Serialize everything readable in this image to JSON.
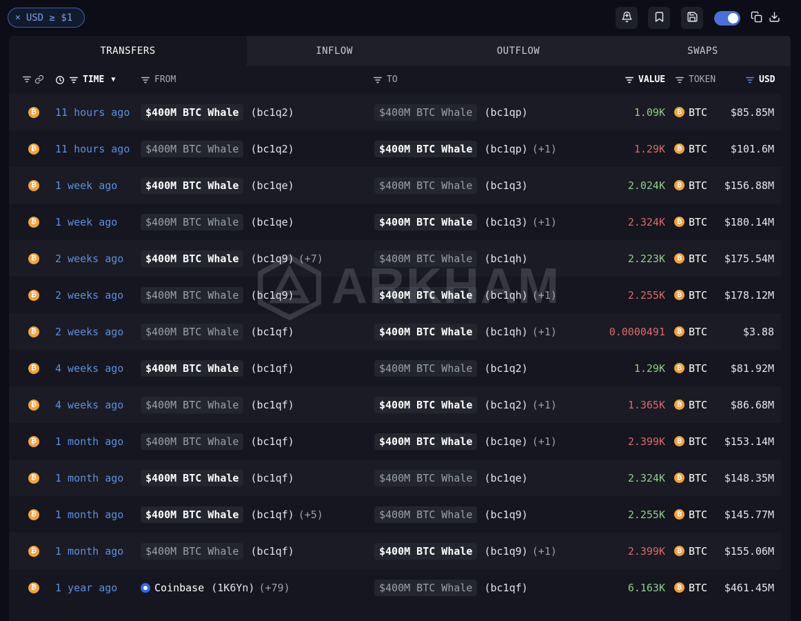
{
  "filter_chip": {
    "label": "USD ≥ $1"
  },
  "tabs": [
    {
      "label": "TRANSFERS",
      "active": true
    },
    {
      "label": "INFLOW",
      "active": false
    },
    {
      "label": "OUTFLOW",
      "active": false
    },
    {
      "label": "SWAPS",
      "active": false
    }
  ],
  "columns": {
    "time": "TIME",
    "from": "FROM",
    "to": "TO",
    "value": "VALUE",
    "token": "TOKEN",
    "usd": "USD"
  },
  "watermark": "ARKHAM",
  "colors": {
    "accent": "#4a6fd6",
    "positive": "#8fcf8a",
    "negative": "#e0676a",
    "btc": "#f2a33a",
    "time_link": "#5d8fe0"
  },
  "rows": [
    {
      "time": "11 hours ago",
      "from_name": "$400M BTC Whale",
      "from_addr": "(bc1q2)",
      "from_extra": "",
      "to_name": "$400M BTC Whale",
      "to_addr": "(bc1qp)",
      "to_extra": "",
      "value": "1.09K",
      "token": "BTC",
      "usd": "$85.85M"
    },
    {
      "time": "11 hours ago",
      "from_name": "$400M BTC Whale",
      "from_addr": "(bc1q2)",
      "from_extra": "",
      "to_name": "$400M BTC Whale",
      "to_addr": "(bc1qp)",
      "to_extra": "(+1)",
      "value": "1.29K",
      "token": "BTC",
      "usd": "$101.6M"
    },
    {
      "time": "1 week ago",
      "from_name": "$400M BTC Whale",
      "from_addr": "(bc1qe)",
      "from_extra": "",
      "to_name": "$400M BTC Whale",
      "to_addr": "(bc1q3)",
      "to_extra": "",
      "value": "2.024K",
      "token": "BTC",
      "usd": "$156.88M"
    },
    {
      "time": "1 week ago",
      "from_name": "$400M BTC Whale",
      "from_addr": "(bc1qe)",
      "from_extra": "",
      "to_name": "$400M BTC Whale",
      "to_addr": "(bc1q3)",
      "to_extra": "(+1)",
      "value": "2.324K",
      "token": "BTC",
      "usd": "$180.14M"
    },
    {
      "time": "2 weeks ago",
      "from_name": "$400M BTC Whale",
      "from_addr": "(bc1q9)",
      "from_extra": "(+7)",
      "to_name": "$400M BTC Whale",
      "to_addr": "(bc1qh)",
      "to_extra": "",
      "value": "2.223K",
      "token": "BTC",
      "usd": "$175.54M"
    },
    {
      "time": "2 weeks ago",
      "from_name": "$400M BTC Whale",
      "from_addr": "(bc1q9)",
      "from_extra": "",
      "to_name": "$400M BTC Whale",
      "to_addr": "(bc1qh)",
      "to_extra": "(+1)",
      "value": "2.255K",
      "token": "BTC",
      "usd": "$178.12M"
    },
    {
      "time": "2 weeks ago",
      "from_name": "$400M BTC Whale",
      "from_addr": "(bc1qf)",
      "from_extra": "",
      "to_name": "$400M BTC Whale",
      "to_addr": "(bc1qh)",
      "to_extra": "(+1)",
      "value": "0.0000491",
      "token": "BTC",
      "usd": "$3.88"
    },
    {
      "time": "4 weeks ago",
      "from_name": "$400M BTC Whale",
      "from_addr": "(bc1qf)",
      "from_extra": "",
      "to_name": "$400M BTC Whale",
      "to_addr": "(bc1q2)",
      "to_extra": "",
      "value": "1.29K",
      "token": "BTC",
      "usd": "$81.92M"
    },
    {
      "time": "4 weeks ago",
      "from_name": "$400M BTC Whale",
      "from_addr": "(bc1qf)",
      "from_extra": "",
      "to_name": "$400M BTC Whale",
      "to_addr": "(bc1q2)",
      "to_extra": "(+1)",
      "value": "1.365K",
      "token": "BTC",
      "usd": "$86.68M"
    },
    {
      "time": "1 month ago",
      "from_name": "$400M BTC Whale",
      "from_addr": "(bc1qf)",
      "from_extra": "",
      "to_name": "$400M BTC Whale",
      "to_addr": "(bc1qe)",
      "to_extra": "(+1)",
      "value": "2.399K",
      "token": "BTC",
      "usd": "$153.14M"
    },
    {
      "time": "1 month ago",
      "from_name": "$400M BTC Whale",
      "from_addr": "(bc1qf)",
      "from_extra": "",
      "to_name": "$400M BTC Whale",
      "to_addr": "(bc1qe)",
      "to_extra": "",
      "value": "2.324K",
      "token": "BTC",
      "usd": "$148.35M"
    },
    {
      "time": "1 month ago",
      "from_name": "$400M BTC Whale",
      "from_addr": "(bc1qf)",
      "from_extra": "(+5)",
      "to_name": "$400M BTC Whale",
      "to_addr": "(bc1q9)",
      "to_extra": "",
      "value": "2.255K",
      "token": "BTC",
      "usd": "$145.77M"
    },
    {
      "time": "1 month ago",
      "from_name": "$400M BTC Whale",
      "from_addr": "(bc1qf)",
      "from_extra": "",
      "to_name": "$400M BTC Whale",
      "to_addr": "(bc1q9)",
      "to_extra": "(+1)",
      "value": "2.399K",
      "token": "BTC",
      "usd": "$155.06M"
    },
    {
      "time": "1 year ago",
      "from_name": "Coinbase",
      "from_addr": "(1K6Yn)",
      "from_extra": "(+79)",
      "to_name": "$400M BTC Whale",
      "to_addr": "(bc1qf)",
      "to_extra": "",
      "value": "6.163K",
      "token": "BTC",
      "usd": "$461.45M"
    }
  ]
}
